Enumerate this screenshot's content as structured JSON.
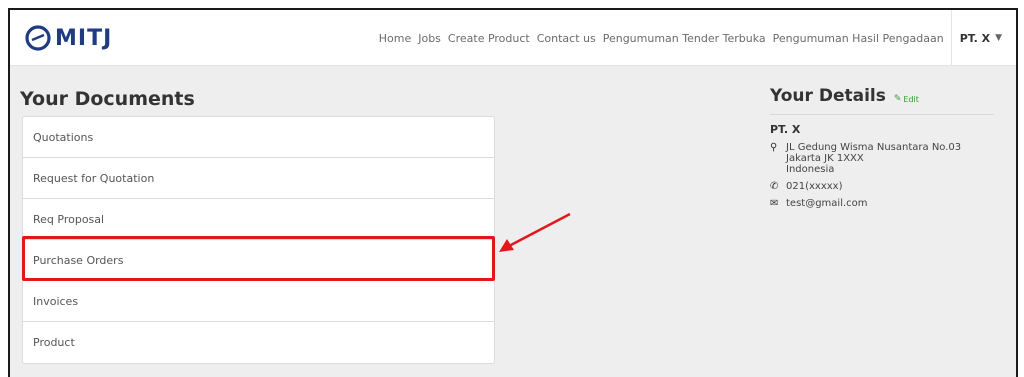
{
  "brand": {
    "logo_text": "MITJ",
    "color": "#1f3b82"
  },
  "nav": {
    "links": [
      "Home",
      "Jobs",
      "Create Product",
      "Contact us",
      "Pengumuman Tender Terbuka",
      "Pengumuman Hasil Pengadaan"
    ],
    "user": "PT. X"
  },
  "documents": {
    "title": "Your Documents",
    "items": [
      "Quotations",
      "Request for Quotation",
      "Req Proposal",
      "Purchase Orders",
      "Invoices",
      "Product"
    ]
  },
  "details": {
    "title": "Your Details",
    "edit_label": "Edit",
    "company": "PT. X",
    "address_line1": "JL Gedung Wisma Nusantara No.03",
    "address_line2": "Jakarta JK 1XXX",
    "address_line3": "Indonesia",
    "phone": "021(xxxxx)",
    "email": "test@gmail.com"
  },
  "annotation": {
    "color": "#e3161b"
  }
}
